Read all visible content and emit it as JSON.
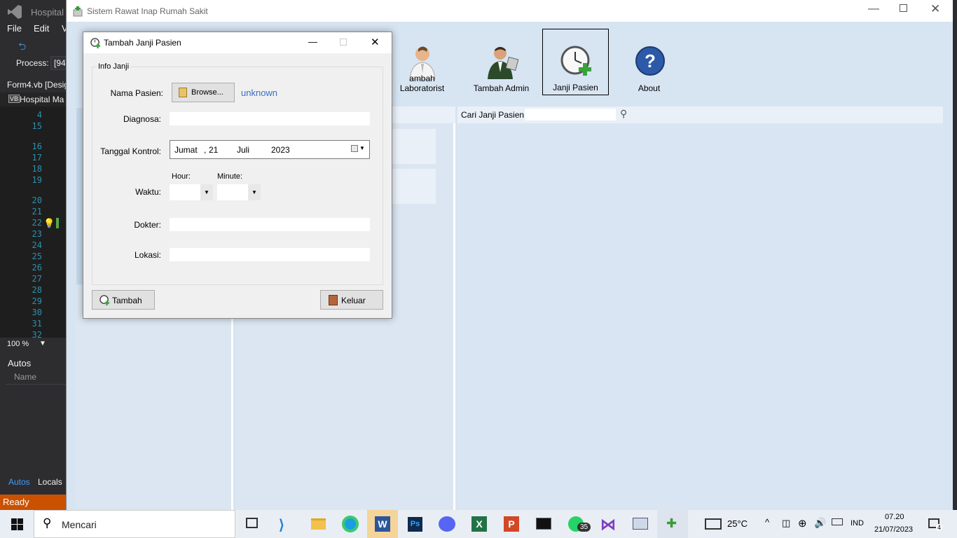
{
  "vs": {
    "title": "Hospital M",
    "menu": [
      "File",
      "Edit",
      "V"
    ],
    "process_label": "Process:",
    "process_value": "[94",
    "tab": "Form4.vb [Desig",
    "solution": "Hospital Ma",
    "line_numbers": [
      "4",
      "15",
      "16",
      "17",
      "18",
      "19",
      "20",
      "21",
      "22",
      "23",
      "24",
      "25",
      "26",
      "27",
      "28",
      "29",
      "30",
      "31",
      "32"
    ],
    "zoom": "100 %",
    "autos_title": "Autos",
    "autos_col": "Name",
    "tab_autos": "Autos",
    "tab_locals": "Locals",
    "status": "Ready"
  },
  "app": {
    "title": "Sistem Rawat Inap Rumah Sakit",
    "toolbar": [
      {
        "label": "ambah Laboratorist",
        "icon": "doctor-icon"
      },
      {
        "label": "Tambah Admin",
        "icon": "admin-icon"
      },
      {
        "label": "Janji Pasien",
        "icon": "clock-add-icon"
      },
      {
        "label": "About",
        "icon": "help-icon"
      }
    ],
    "search_label": "Cari Janji Pasien:"
  },
  "dialog": {
    "title": "Tambah Janji Pasien",
    "group": "Info Janji",
    "nama_label": "Nama Pasien:",
    "browse": "Browse...",
    "patient_value": "unknown",
    "diagnosa_label": "Diagnosa:",
    "tanggal_label": "Tanggal Kontrol:",
    "date_day": "Jumat",
    "date_sep": ",",
    "date_num": "21",
    "date_month": "Juli",
    "date_year": "2023",
    "hour_label": "Hour:",
    "minute_label": "Minute:",
    "waktu_label": "Waktu:",
    "dokter_label": "Dokter:",
    "lokasi_label": "Lokasi:",
    "tambah": "Tambah",
    "keluar": "Keluar"
  },
  "taskbar": {
    "search_placeholder": "Mencari",
    "badge_whatsapp": "35",
    "weather": "25°C",
    "lang": "IND",
    "time": "07.20",
    "date": "21/07/2023",
    "notif": "4"
  }
}
